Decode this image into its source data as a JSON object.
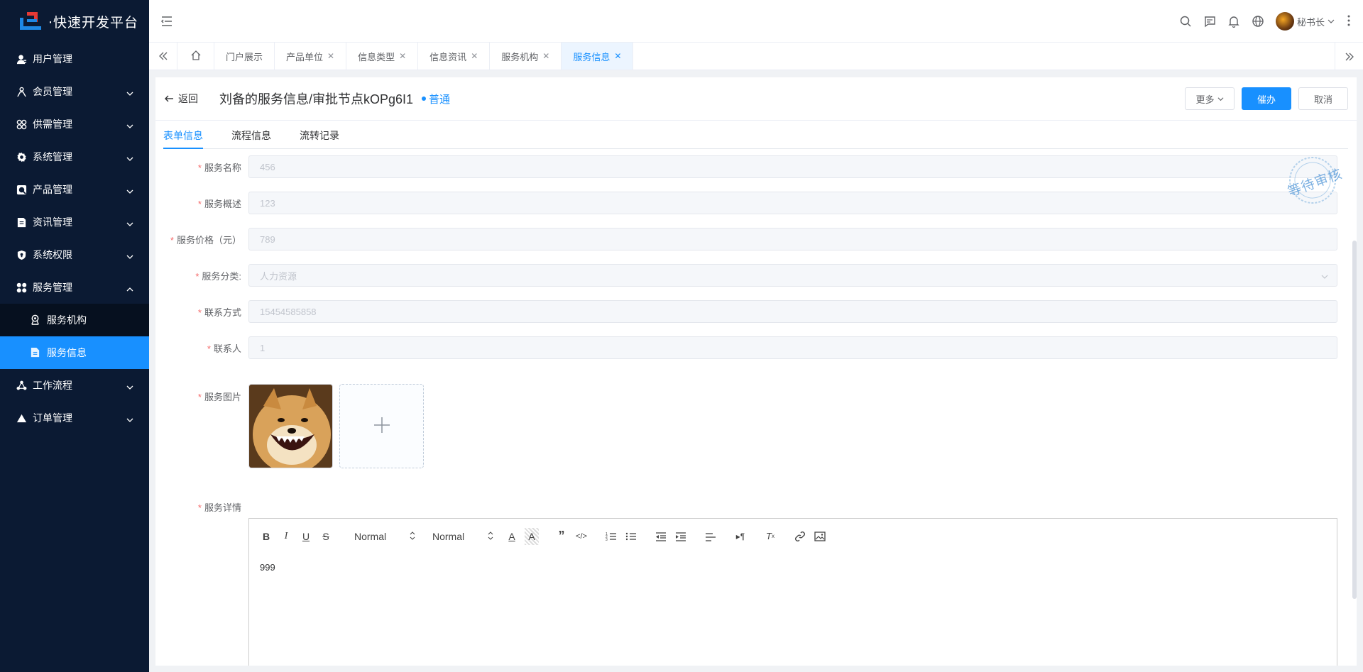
{
  "app": {
    "title": "·快速开发平台"
  },
  "sidebar": {
    "items": [
      {
        "label": "用户管理",
        "icon": "user-icon",
        "expandable": false
      },
      {
        "label": "会员管理",
        "icon": "member-icon",
        "expandable": true
      },
      {
        "label": "供需管理",
        "icon": "supply-icon",
        "expandable": true
      },
      {
        "label": "系统管理",
        "icon": "gear-icon",
        "expandable": true
      },
      {
        "label": "产品管理",
        "icon": "product-icon",
        "expandable": true
      },
      {
        "label": "资讯管理",
        "icon": "document-icon",
        "expandable": true
      },
      {
        "label": "系统权限",
        "icon": "shield-icon",
        "expandable": true
      },
      {
        "label": "服务管理",
        "icon": "service-icon",
        "expandable": true,
        "expanded": true
      }
    ],
    "subitems": [
      {
        "label": "服务机构",
        "icon": "org-icon"
      },
      {
        "label": "服务信息",
        "icon": "file-icon",
        "active": true
      }
    ],
    "items_after": [
      {
        "label": "工作流程",
        "icon": "workflow-icon",
        "expandable": true
      },
      {
        "label": "订单管理",
        "icon": "triangle-icon",
        "expandable": true
      }
    ]
  },
  "header": {
    "user_name": "秘书长"
  },
  "tabs": [
    {
      "label": "门户展示",
      "closable": false
    },
    {
      "label": "产品单位",
      "closable": true
    },
    {
      "label": "信息类型",
      "closable": true
    },
    {
      "label": "信息资讯",
      "closable": true
    },
    {
      "label": "服务机构",
      "closable": true
    },
    {
      "label": "服务信息",
      "closable": true,
      "active": true
    }
  ],
  "page": {
    "back_label": "返回",
    "title": "刘备的服务信息/审批节点kOPg6I1",
    "status": "普通",
    "more_label": "更多",
    "handle_label": "催办",
    "cancel_label": "取消",
    "stamp": "等待审核"
  },
  "subtabs": [
    "表单信息",
    "流程信息",
    "流转记录"
  ],
  "form": {
    "fields": [
      {
        "label": "服务名称",
        "value": "456"
      },
      {
        "label": "服务概述",
        "value": "123"
      },
      {
        "label": "服务价格（元）",
        "value": "789"
      },
      {
        "label": "服务分类:",
        "value": "人力资源",
        "select": true
      },
      {
        "label": "联系方式",
        "value": "15454585858"
      },
      {
        "label": "联系人",
        "value": "1"
      }
    ],
    "image_label": "服务图片",
    "detail_label": "服务详情",
    "editor": {
      "font_size": "Normal",
      "header": "Normal",
      "content": "999"
    }
  },
  "colors": {
    "primary": "#1890ff",
    "sidebar": "#0b1a33",
    "required": "#f56c6c"
  }
}
